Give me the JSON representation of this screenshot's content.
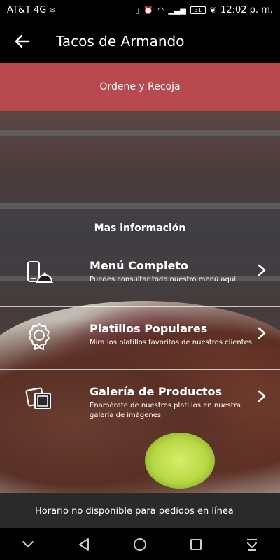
{
  "status_bar": {
    "carrier": "AT&T 4G",
    "time": "12:02 p. m.",
    "battery": "31"
  },
  "app_bar": {
    "title": "Tacos de Armando"
  },
  "banner": {
    "order_label": "Ordene y Recoja"
  },
  "section": {
    "heading": "Mas información"
  },
  "menu_items": [
    {
      "title": "Menú Completo",
      "description": "Puedes consultar todo nuestro menú aquí",
      "icon": "phone-dish-icon"
    },
    {
      "title": "Platillos Populares",
      "description": "Mira los platillos favoritos de nuestros clientes",
      "icon": "award-icon"
    },
    {
      "title": "Galería de Productos",
      "description": "Enamórate de nuestros platillos en nuestra galería de imágenes",
      "icon": "gallery-icon"
    }
  ],
  "notice": {
    "text": "Horario no disponible para pedidos en línea"
  },
  "colors": {
    "banner": "#c44a50",
    "notice_bg": "#2a2a2a"
  }
}
